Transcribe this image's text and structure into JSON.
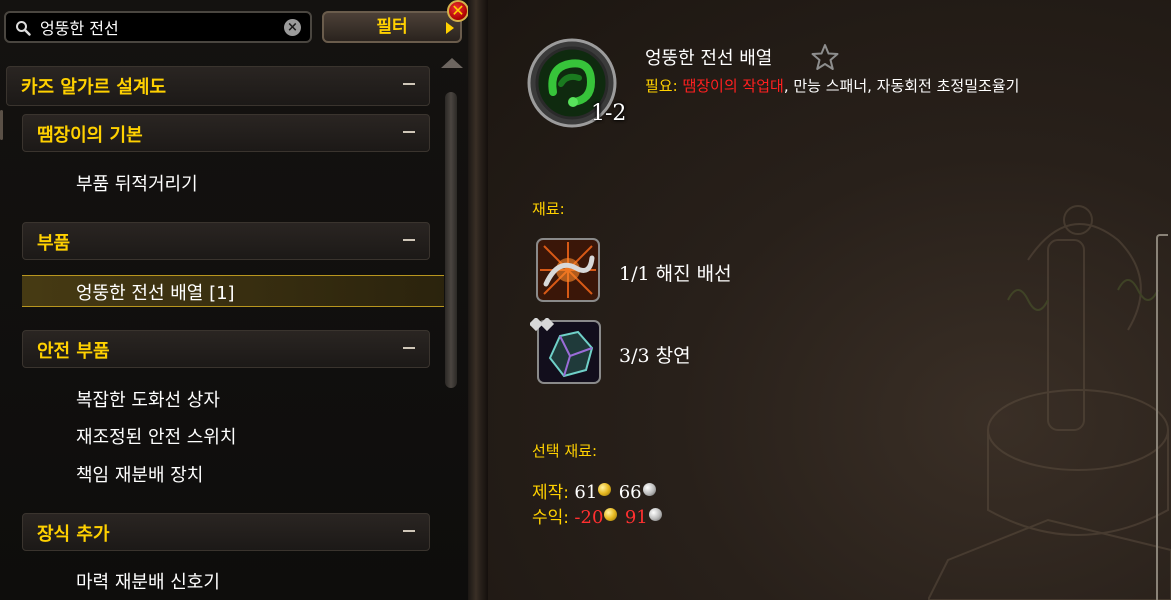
{
  "search": {
    "value": "엉뚱한 전선",
    "clear_symbol": "×"
  },
  "filter": {
    "label": "필터"
  },
  "close": {
    "symbol": "✕"
  },
  "tree": {
    "categories": [
      {
        "label": "카즈 알가르 설계도"
      },
      {
        "label": "땜장이의 기본"
      },
      {
        "label": "부품"
      },
      {
        "label": "안전 부품"
      },
      {
        "label": "장식 추가"
      }
    ],
    "recipes": [
      {
        "label": "부품 뒤적거리기"
      },
      {
        "label": "엉뚱한 전선 배열 [1]"
      },
      {
        "label": "복잡한 도화선 상자"
      },
      {
        "label": "재조정된 안전 스위치"
      },
      {
        "label": "책임 재분배 장치"
      },
      {
        "label": "마력 재분배 신호기"
      }
    ]
  },
  "recipe": {
    "name": "엉뚱한 전선 배열",
    "quantity": "1-2",
    "requires_label": "필요:",
    "requires_missing": "땜장이의 작업대",
    "requires_rest": ", 만능 스패너, 자동회전 초정밀조율기"
  },
  "reagents": {
    "header": "재료:",
    "items": [
      {
        "count": "1/1",
        "name": "해진 배선",
        "icon": "frayed-wire-icon"
      },
      {
        "count": "3/3",
        "name": "창연",
        "icon": "bismuth-ore-icon"
      }
    ]
  },
  "optional": {
    "header": "선택 재료:"
  },
  "cost": {
    "craft_label": "제작:",
    "craft_gold": "61",
    "craft_silver": "66",
    "profit_label": "수익:",
    "profit_gold": "-20",
    "profit_silver": "91"
  },
  "colors": {
    "gold_text": "#ffd100",
    "red_text": "#ff2020",
    "selected_border": "#b8961f"
  }
}
